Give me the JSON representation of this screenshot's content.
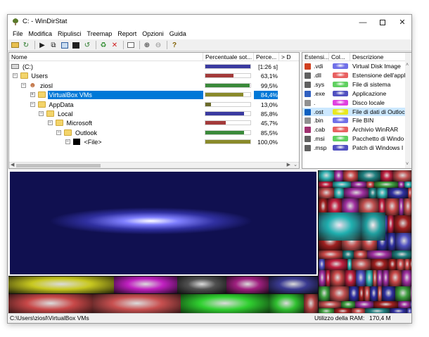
{
  "window": {
    "title": "C: - WinDirStat"
  },
  "menu": [
    "File",
    "Modifica",
    "Ripulisci",
    "Treemap",
    "Report",
    "Opzioni",
    "Guida"
  ],
  "tree": {
    "columns": [
      "Nome",
      "Percentuale sot...",
      "Perce...",
      "> D"
    ],
    "rows": [
      {
        "name": "(C:)",
        "pct": "[1:26 s]",
        "fill": 1.0,
        "color": "#3a3aa0",
        "level": 0,
        "icon": "drive",
        "expander": "",
        "selected": false
      },
      {
        "name": "Users",
        "pct": "63,1%",
        "fill": 0.63,
        "color": "#a33a3a",
        "level": 1,
        "icon": "folder",
        "expander": "-",
        "selected": false
      },
      {
        "name": "ziosl",
        "pct": "99,5%",
        "fill": 0.99,
        "color": "#3a8a3a",
        "level": 2,
        "icon": "user",
        "expander": "-",
        "selected": false
      },
      {
        "name": "VirtualBox VMs",
        "pct": "84,4%",
        "fill": 0.84,
        "color": "#8a8a2a",
        "level": 3,
        "icon": "folder",
        "expander": "+",
        "selected": true
      },
      {
        "name": "AppData",
        "pct": "13,0%",
        "fill": 0.13,
        "color": "#6a6a2a",
        "level": 3,
        "icon": "folder",
        "expander": "-",
        "selected": false
      },
      {
        "name": "Local",
        "pct": "85,8%",
        "fill": 0.86,
        "color": "#3a3aa0",
        "level": 4,
        "icon": "folder",
        "expander": "-",
        "selected": false
      },
      {
        "name": "Microsoft",
        "pct": "45,7%",
        "fill": 0.46,
        "color": "#a33a3a",
        "level": 5,
        "icon": "folder",
        "expander": "-",
        "selected": false
      },
      {
        "name": "Outlook",
        "pct": "85,5%",
        "fill": 0.86,
        "color": "#3a8a3a",
        "level": 6,
        "icon": "folder",
        "expander": "-",
        "selected": false
      },
      {
        "name": "<File>",
        "pct": "100,0%",
        "fill": 1.0,
        "color": "#8a8a2a",
        "level": 7,
        "icon": "file-black",
        "expander": "-",
        "selected": false
      }
    ]
  },
  "extensions": {
    "columns": [
      "Estensi...",
      "Col...",
      "Descrizione"
    ],
    "rows": [
      {
        "ext": ".vdi",
        "color": "#7070e8",
        "desc": "Virtual Disk Image",
        "icon": "box-icon",
        "icon_color": "#d04020",
        "selected": false
      },
      {
        "ext": ".dll",
        "color": "#e86060",
        "desc": "Estensione dell'appl",
        "icon": "gear-file-icon",
        "icon_color": "#606060",
        "selected": false
      },
      {
        "ext": ".sys",
        "color": "#60d060",
        "desc": "File di sistema",
        "icon": "gear-file-icon",
        "icon_color": "#606060",
        "selected": false
      },
      {
        "ext": ".exe",
        "color": "#5050c0",
        "desc": "Applicazione",
        "icon": "window-file-icon",
        "icon_color": "#3060c0",
        "selected": false
      },
      {
        "ext": ".",
        "color": "#e040e0",
        "desc": "Disco locale",
        "icon": "blank-file-icon",
        "icon_color": "#909090",
        "selected": false
      },
      {
        "ext": ".ost",
        "color": "#e8e820",
        "desc": "File di dati di Outloc",
        "icon": "outlook-icon",
        "icon_color": "#1060c0",
        "selected": true
      },
      {
        "ext": ".bin",
        "color": "#7070e8",
        "desc": "File BIN",
        "icon": "blank-file-icon",
        "icon_color": "#909090",
        "selected": false
      },
      {
        "ext": ".cab",
        "color": "#e86060",
        "desc": "Archivio WinRAR",
        "icon": "archive-icon",
        "icon_color": "#a03070",
        "selected": false
      },
      {
        "ext": ".msi",
        "color": "#60d060",
        "desc": "Pacchetto di Windo",
        "icon": "installer-icon",
        "icon_color": "#606060",
        "selected": false
      },
      {
        "ext": ".msp",
        "color": "#5050c0",
        "desc": "Patch di Windows I",
        "icon": "installer-icon",
        "icon_color": "#606060",
        "selected": false
      }
    ]
  },
  "status": {
    "path": "C:\\Users\\ziosl\\VirtualBox VMs",
    "ram_label": "Utilizzo della RAM:",
    "ram_value": "170,4 M"
  }
}
